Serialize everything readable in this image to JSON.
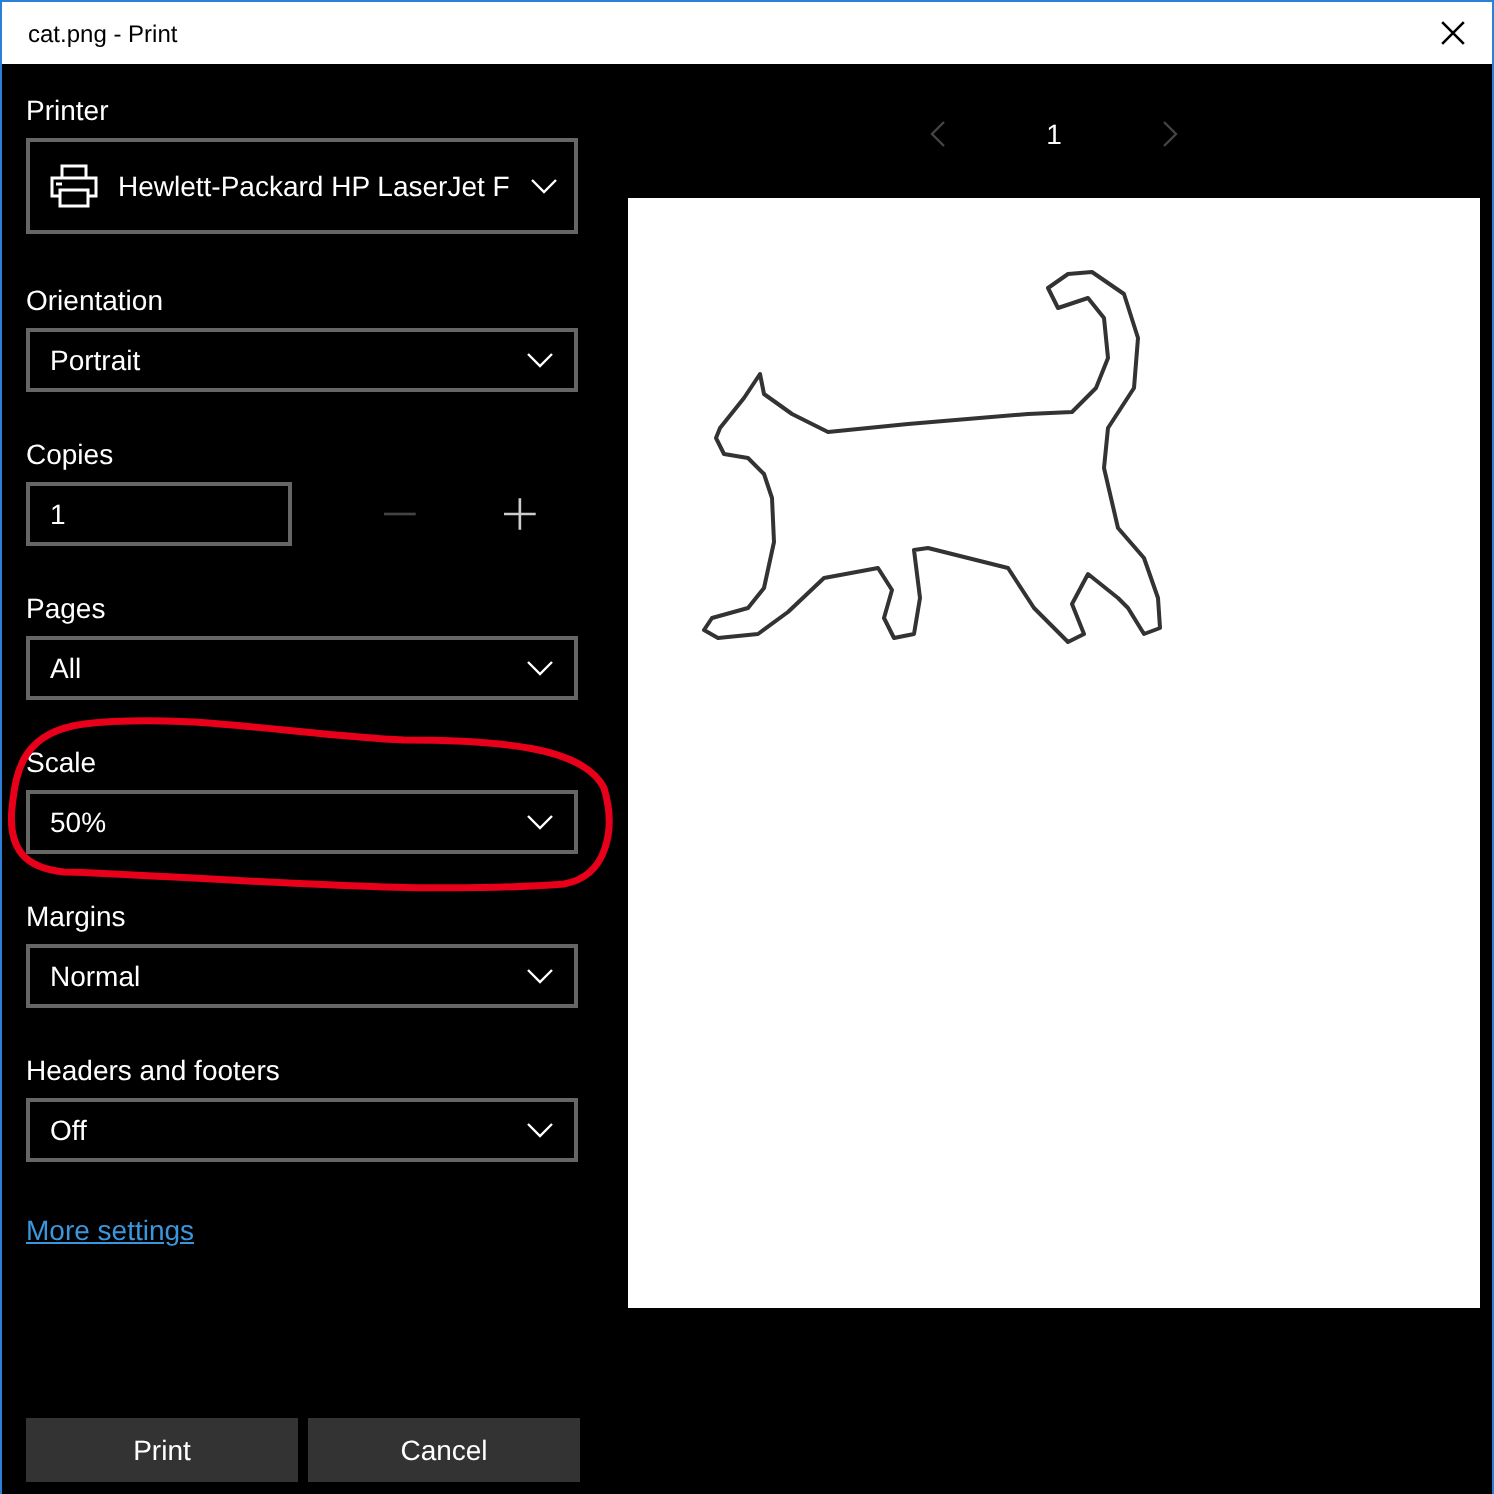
{
  "window": {
    "title": "cat.png - Print"
  },
  "settings": [
    {
      "kind": "printer",
      "label": "Printer",
      "value": "Hewlett-Packard HP LaserJet F"
    },
    {
      "kind": "dropdown",
      "label": "Orientation",
      "value": "Portrait"
    },
    {
      "kind": "stepper",
      "label": "Copies",
      "value": "1",
      "decrease_disabled": true,
      "increase_disabled": false
    },
    {
      "kind": "dropdown",
      "label": "Pages",
      "value": "All"
    },
    {
      "kind": "dropdown",
      "label": "Scale",
      "value": "50%"
    },
    {
      "kind": "dropdown",
      "label": "Margins",
      "value": "Normal"
    },
    {
      "kind": "dropdown",
      "label": "Headers and footers",
      "value": "Off"
    }
  ],
  "more_settings": "More settings",
  "preview": {
    "page": "1",
    "prev_disabled": true,
    "next_disabled": true
  },
  "buttons": [
    {
      "label": "Print"
    },
    {
      "label": "Cancel"
    }
  ]
}
